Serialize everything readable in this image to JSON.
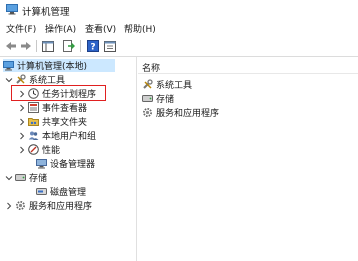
{
  "window": {
    "title": "计算机管理"
  },
  "menu": [
    {
      "label": "文件(F)"
    },
    {
      "label": "操作(A)"
    },
    {
      "label": "查看(V)"
    },
    {
      "label": "帮助(H)"
    }
  ],
  "toolbar": {
    "buttons": [
      "back-arrow-icon",
      "forward-arrow-icon",
      "show-hide-tree-icon",
      "export-list-icon",
      "help-icon",
      "properties-icon"
    ]
  },
  "tree": {
    "root": "计算机管理(本地)",
    "system_tools": "系统工具",
    "task_scheduler": "任务计划程序",
    "event_viewer": "事件查看器",
    "shared_folders": "共享文件夹",
    "local_users_groups": "本地用户和组",
    "performance": "性能",
    "device_manager": "设备管理器",
    "storage": "存储",
    "disk_management": "磁盘管理",
    "services_apps": "服务和应用程序"
  },
  "list": {
    "column_name": "名称",
    "items": [
      "系统工具",
      "存储",
      "服务和应用程序"
    ]
  },
  "colors": {
    "highlight": "#e02020",
    "selection": "#cce8ff"
  }
}
